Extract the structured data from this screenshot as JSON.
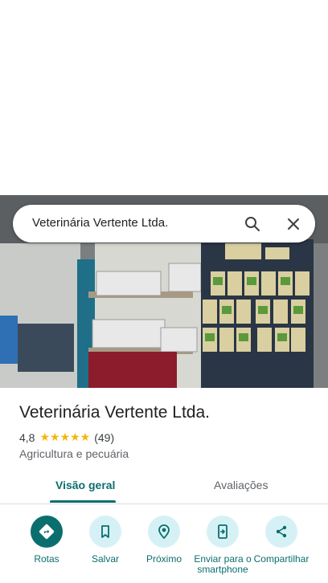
{
  "search": {
    "query": "Veterinária Vertente Ltda."
  },
  "place": {
    "name": "Veterinária Vertente Ltda.",
    "rating": "4,8",
    "stars": "★★★★★",
    "reviews_count": "(49)",
    "category": "Agricultura e pecuária"
  },
  "tabs": [
    {
      "label": "Visão geral",
      "selected": true
    },
    {
      "label": "Avaliações",
      "selected": false
    }
  ],
  "actions": [
    {
      "label": "Rotas",
      "icon": "directions-icon"
    },
    {
      "label": "Salvar",
      "icon": "bookmark-icon"
    },
    {
      "label": "Próximo",
      "icon": "nearby-icon"
    },
    {
      "label": "Enviar para o smartphone",
      "icon": "send-to-phone-icon"
    },
    {
      "label": "Compartilhar",
      "icon": "share-icon"
    }
  ],
  "colors": {
    "accent": "#0b6e6e",
    "chip": "#d6f1f5",
    "star": "#f5b50a"
  }
}
